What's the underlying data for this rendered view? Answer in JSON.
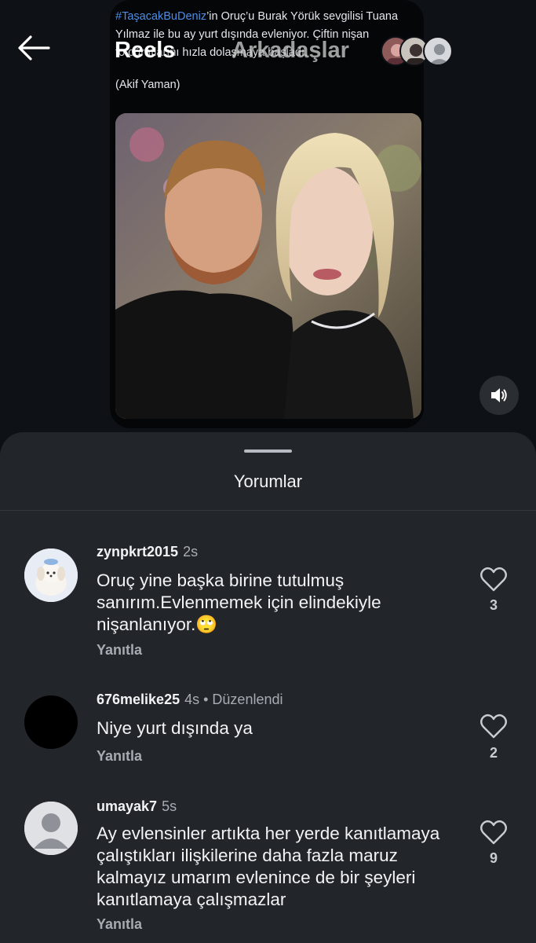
{
  "header": {
    "tabs": [
      "Reels",
      "Arkadaşlar"
    ]
  },
  "post": {
    "caption_tag": "#TaşacakBuDeniz",
    "caption_text": "’in Oruç’u Burak Yörük sevgilisi Tuana Yılmaz ile bu ay yurt dışında evleniyor. Çiftin nişan fotoğraflarını hızla dolaşmaya başladı.",
    "credit": "(Akif Yaman)"
  },
  "sheet": {
    "title": "Yorumlar"
  },
  "comments": [
    {
      "user": "zynpkrt2015",
      "time": "2s",
      "edited": "",
      "text": "Oruç yine başka birine tutulmuş sanırım.Evlenmemek için elindekiyle nişanlanıyor.🙄",
      "reply": "Yanıtla",
      "likes": "3",
      "avatar": "puppy-avatar"
    },
    {
      "user": "676melike25",
      "time": "4s",
      "edited": "Düzenlendi",
      "text": "Niye yurt dışında ya",
      "reply": "Yanıtla",
      "likes": "2",
      "avatar": "black-avatar"
    },
    {
      "user": "umayak7",
      "time": "5s",
      "edited": "",
      "text": "Ay evlensinler artıkta her yerde kanıtlamaya çalıştıkları ilişkilerine daha fazla maruz kalmayız umarım evlenince de bir şeyleri kanıtlamaya çalışmazlar",
      "reply": "Yanıtla",
      "likes": "9",
      "avatar": "default-avatar"
    }
  ],
  "colors": {
    "background": "#0c0f13",
    "sheet": "#22252a",
    "hashtag": "#4c8ee6",
    "muted_text": "#a8acb2"
  }
}
